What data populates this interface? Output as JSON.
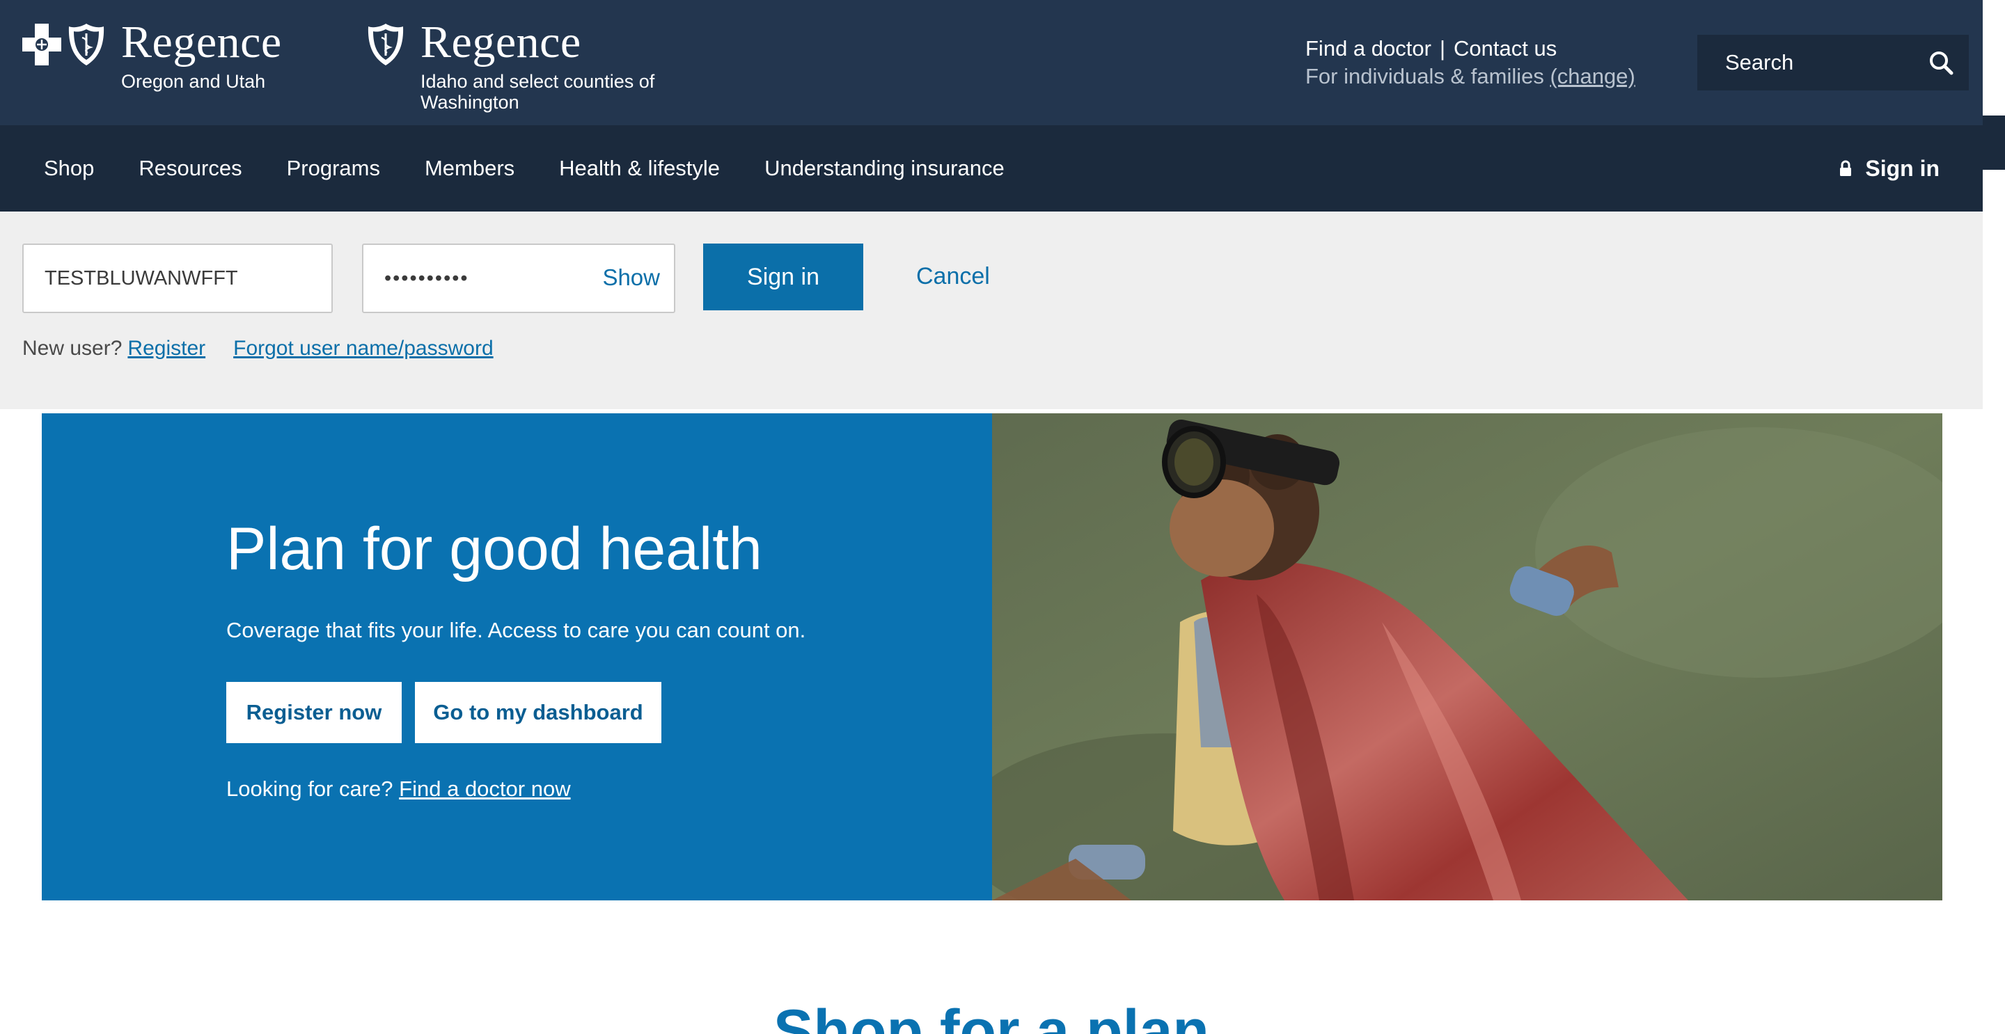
{
  "header": {
    "brands": [
      {
        "name": "Regence",
        "region": "Oregon and Utah"
      },
      {
        "name": "Regence",
        "region": "Idaho and select counties of Washington"
      }
    ],
    "utility": {
      "find_doctor": "Find a doctor",
      "separator": "|",
      "contact_us": "Contact us",
      "audience_text": "For individuals & families",
      "change_label": "(change)"
    },
    "search": {
      "placeholder": "Search",
      "icon": "search-icon"
    }
  },
  "nav": {
    "items": [
      {
        "label": "Shop"
      },
      {
        "label": "Resources"
      },
      {
        "label": "Programs"
      },
      {
        "label": "Members"
      },
      {
        "label": "Health & lifestyle"
      },
      {
        "label": "Understanding insurance"
      }
    ],
    "sign_in": {
      "label": "Sign in",
      "icon": "lock-icon"
    }
  },
  "signin_panel": {
    "username_value": "TESTBLUWANWFFT",
    "password_masked": "••••••••••",
    "show_label": "Show",
    "submit_label": "Sign in",
    "cancel_label": "Cancel",
    "new_user_text": "New user?",
    "register_label": "Register",
    "forgot_label": "Forgot user name/password"
  },
  "hero": {
    "title": "Plan for good health",
    "subtitle": "Coverage that fits your life. Access to care you can count on.",
    "primary_button": "Register now",
    "secondary_button": "Go to my dashboard",
    "care_text": "Looking for care?",
    "care_link": "Find a doctor now",
    "image": "child-in-superhero-cape-photo"
  },
  "next_section": {
    "heading": "Shop for a plan"
  },
  "colors": {
    "header_bg": "#23364f",
    "nav_bg": "#1b2a3d",
    "accent": "#0b6fa9",
    "hero_bg": "#0a72b1",
    "panel_bg": "#efefef"
  }
}
